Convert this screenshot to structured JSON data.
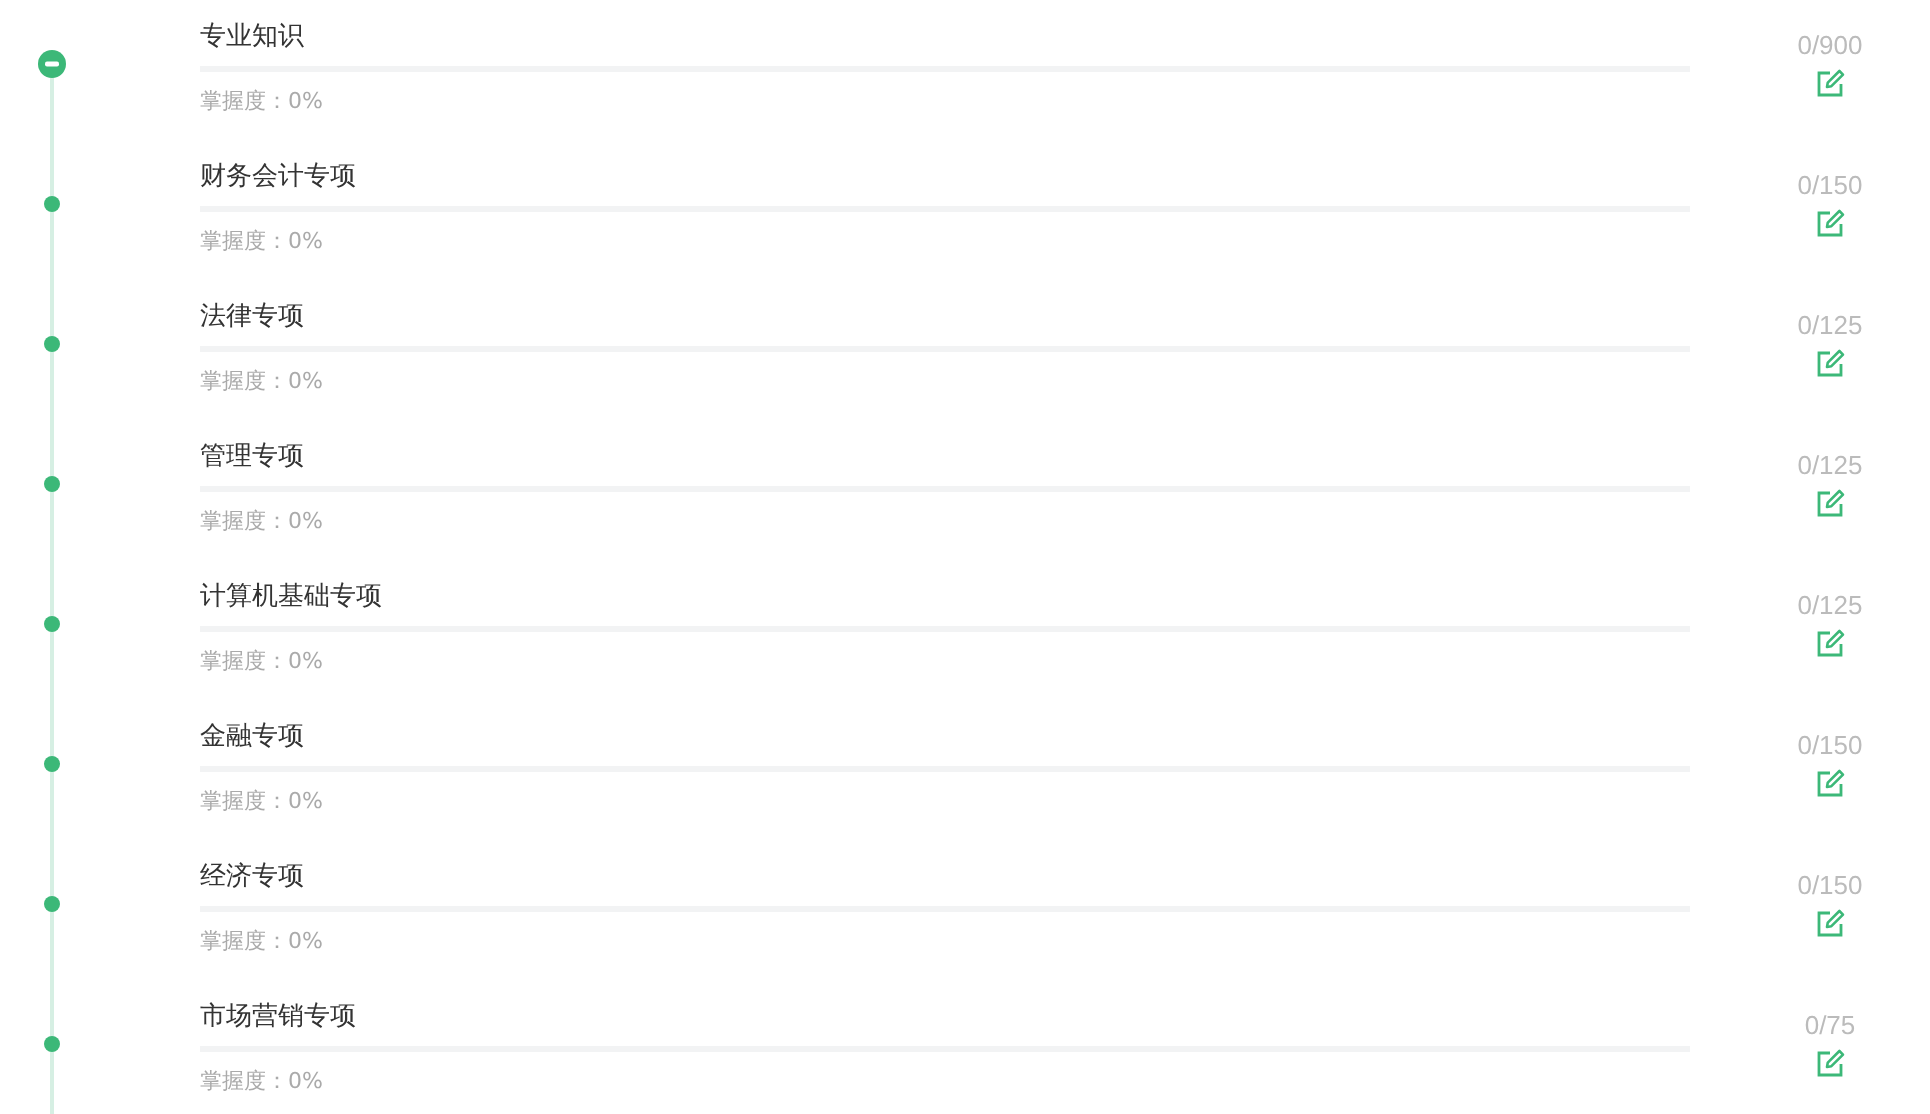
{
  "chapters": [
    {
      "title": "专业知识",
      "mastery": "掌握度：0%",
      "level": 0,
      "count": "0/900",
      "expanded": true
    },
    {
      "title": "财务会计专项",
      "mastery": "掌握度：0%",
      "level": 0,
      "count": "0/150",
      "expanded": false
    },
    {
      "title": "法律专项",
      "mastery": "掌握度：0%",
      "level": 0,
      "count": "0/125",
      "expanded": false
    },
    {
      "title": "管理专项",
      "mastery": "掌握度：0%",
      "level": 0,
      "count": "0/125",
      "expanded": false
    },
    {
      "title": "计算机基础专项",
      "mastery": "掌握度：0%",
      "level": 0,
      "count": "0/125",
      "expanded": false
    },
    {
      "title": "金融专项",
      "mastery": "掌握度：0%",
      "level": 0,
      "count": "0/150",
      "expanded": false
    },
    {
      "title": "经济专项",
      "mastery": "掌握度：0%",
      "level": 0,
      "count": "0/150",
      "expanded": false
    },
    {
      "title": "市场营销专项",
      "mastery": "掌握度：0%",
      "level": 0,
      "count": "0/75",
      "expanded": false
    }
  ]
}
